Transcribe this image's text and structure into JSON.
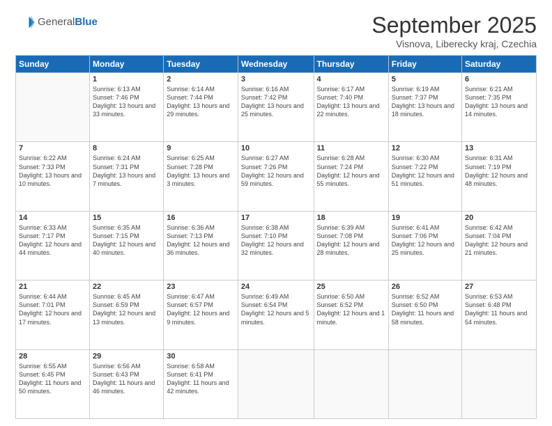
{
  "header": {
    "logo_general": "General",
    "logo_blue": "Blue",
    "month": "September 2025",
    "location": "Visnova, Liberecky kraj, Czechia"
  },
  "days_of_week": [
    "Sunday",
    "Monday",
    "Tuesday",
    "Wednesday",
    "Thursday",
    "Friday",
    "Saturday"
  ],
  "weeks": [
    [
      {
        "day": "",
        "text": ""
      },
      {
        "day": "1",
        "text": "Sunrise: 6:13 AM\nSunset: 7:46 PM\nDaylight: 13 hours\nand 33 minutes."
      },
      {
        "day": "2",
        "text": "Sunrise: 6:14 AM\nSunset: 7:44 PM\nDaylight: 13 hours\nand 29 minutes."
      },
      {
        "day": "3",
        "text": "Sunrise: 6:16 AM\nSunset: 7:42 PM\nDaylight: 13 hours\nand 25 minutes."
      },
      {
        "day": "4",
        "text": "Sunrise: 6:17 AM\nSunset: 7:40 PM\nDaylight: 13 hours\nand 22 minutes."
      },
      {
        "day": "5",
        "text": "Sunrise: 6:19 AM\nSunset: 7:37 PM\nDaylight: 13 hours\nand 18 minutes."
      },
      {
        "day": "6",
        "text": "Sunrise: 6:21 AM\nSunset: 7:35 PM\nDaylight: 13 hours\nand 14 minutes."
      }
    ],
    [
      {
        "day": "7",
        "text": "Sunrise: 6:22 AM\nSunset: 7:33 PM\nDaylight: 13 hours\nand 10 minutes."
      },
      {
        "day": "8",
        "text": "Sunrise: 6:24 AM\nSunset: 7:31 PM\nDaylight: 13 hours\nand 7 minutes."
      },
      {
        "day": "9",
        "text": "Sunrise: 6:25 AM\nSunset: 7:28 PM\nDaylight: 13 hours\nand 3 minutes."
      },
      {
        "day": "10",
        "text": "Sunrise: 6:27 AM\nSunset: 7:26 PM\nDaylight: 12 hours\nand 59 minutes."
      },
      {
        "day": "11",
        "text": "Sunrise: 6:28 AM\nSunset: 7:24 PM\nDaylight: 12 hours\nand 55 minutes."
      },
      {
        "day": "12",
        "text": "Sunrise: 6:30 AM\nSunset: 7:22 PM\nDaylight: 12 hours\nand 51 minutes."
      },
      {
        "day": "13",
        "text": "Sunrise: 6:31 AM\nSunset: 7:19 PM\nDaylight: 12 hours\nand 48 minutes."
      }
    ],
    [
      {
        "day": "14",
        "text": "Sunrise: 6:33 AM\nSunset: 7:17 PM\nDaylight: 12 hours\nand 44 minutes."
      },
      {
        "day": "15",
        "text": "Sunrise: 6:35 AM\nSunset: 7:15 PM\nDaylight: 12 hours\nand 40 minutes."
      },
      {
        "day": "16",
        "text": "Sunrise: 6:36 AM\nSunset: 7:13 PM\nDaylight: 12 hours\nand 36 minutes."
      },
      {
        "day": "17",
        "text": "Sunrise: 6:38 AM\nSunset: 7:10 PM\nDaylight: 12 hours\nand 32 minutes."
      },
      {
        "day": "18",
        "text": "Sunrise: 6:39 AM\nSunset: 7:08 PM\nDaylight: 12 hours\nand 28 minutes."
      },
      {
        "day": "19",
        "text": "Sunrise: 6:41 AM\nSunset: 7:06 PM\nDaylight: 12 hours\nand 25 minutes."
      },
      {
        "day": "20",
        "text": "Sunrise: 6:42 AM\nSunset: 7:04 PM\nDaylight: 12 hours\nand 21 minutes."
      }
    ],
    [
      {
        "day": "21",
        "text": "Sunrise: 6:44 AM\nSunset: 7:01 PM\nDaylight: 12 hours\nand 17 minutes."
      },
      {
        "day": "22",
        "text": "Sunrise: 6:45 AM\nSunset: 6:59 PM\nDaylight: 12 hours\nand 13 minutes."
      },
      {
        "day": "23",
        "text": "Sunrise: 6:47 AM\nSunset: 6:57 PM\nDaylight: 12 hours\nand 9 minutes."
      },
      {
        "day": "24",
        "text": "Sunrise: 6:49 AM\nSunset: 6:54 PM\nDaylight: 12 hours\nand 5 minutes."
      },
      {
        "day": "25",
        "text": "Sunrise: 6:50 AM\nSunset: 6:52 PM\nDaylight: 12 hours\nand 1 minute."
      },
      {
        "day": "26",
        "text": "Sunrise: 6:52 AM\nSunset: 6:50 PM\nDaylight: 11 hours\nand 58 minutes."
      },
      {
        "day": "27",
        "text": "Sunrise: 6:53 AM\nSunset: 6:48 PM\nDaylight: 11 hours\nand 54 minutes."
      }
    ],
    [
      {
        "day": "28",
        "text": "Sunrise: 6:55 AM\nSunset: 6:45 PM\nDaylight: 11 hours\nand 50 minutes."
      },
      {
        "day": "29",
        "text": "Sunrise: 6:56 AM\nSunset: 6:43 PM\nDaylight: 11 hours\nand 46 minutes."
      },
      {
        "day": "30",
        "text": "Sunrise: 6:58 AM\nSunset: 6:41 PM\nDaylight: 11 hours\nand 42 minutes."
      },
      {
        "day": "",
        "text": ""
      },
      {
        "day": "",
        "text": ""
      },
      {
        "day": "",
        "text": ""
      },
      {
        "day": "",
        "text": ""
      }
    ]
  ]
}
